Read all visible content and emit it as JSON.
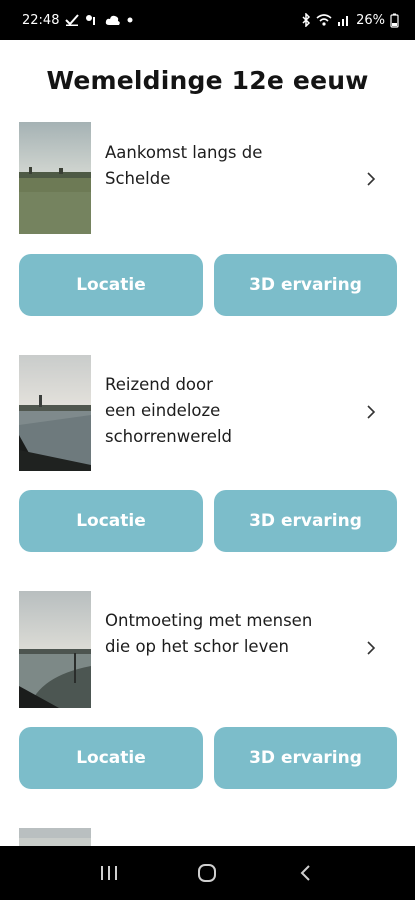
{
  "status": {
    "time": "22:48",
    "battery": "26%"
  },
  "page": {
    "title": "Wemeldinge 12e eeuw"
  },
  "items": [
    {
      "lines": [
        "Aankomst langs de",
        "Schelde"
      ],
      "location_label": "Locatie",
      "experience_label": "3D ervaring"
    },
    {
      "lines": [
        "Reizend door",
        "een eindeloze",
        "schorrenwereld"
      ],
      "location_label": "Locatie",
      "experience_label": "3D ervaring"
    },
    {
      "lines": [
        "Ontmoeting met mensen",
        "die op het schor leven"
      ],
      "location_label": "Locatie",
      "experience_label": "3D ervaring"
    }
  ],
  "colors": {
    "button_bg": "#7cbdca",
    "button_text": "#ffffff"
  },
  "icons": {
    "chevron": "chevron-right-icon",
    "nav_recents": "recent-apps-icon",
    "nav_home": "home-icon",
    "nav_back": "back-icon"
  }
}
